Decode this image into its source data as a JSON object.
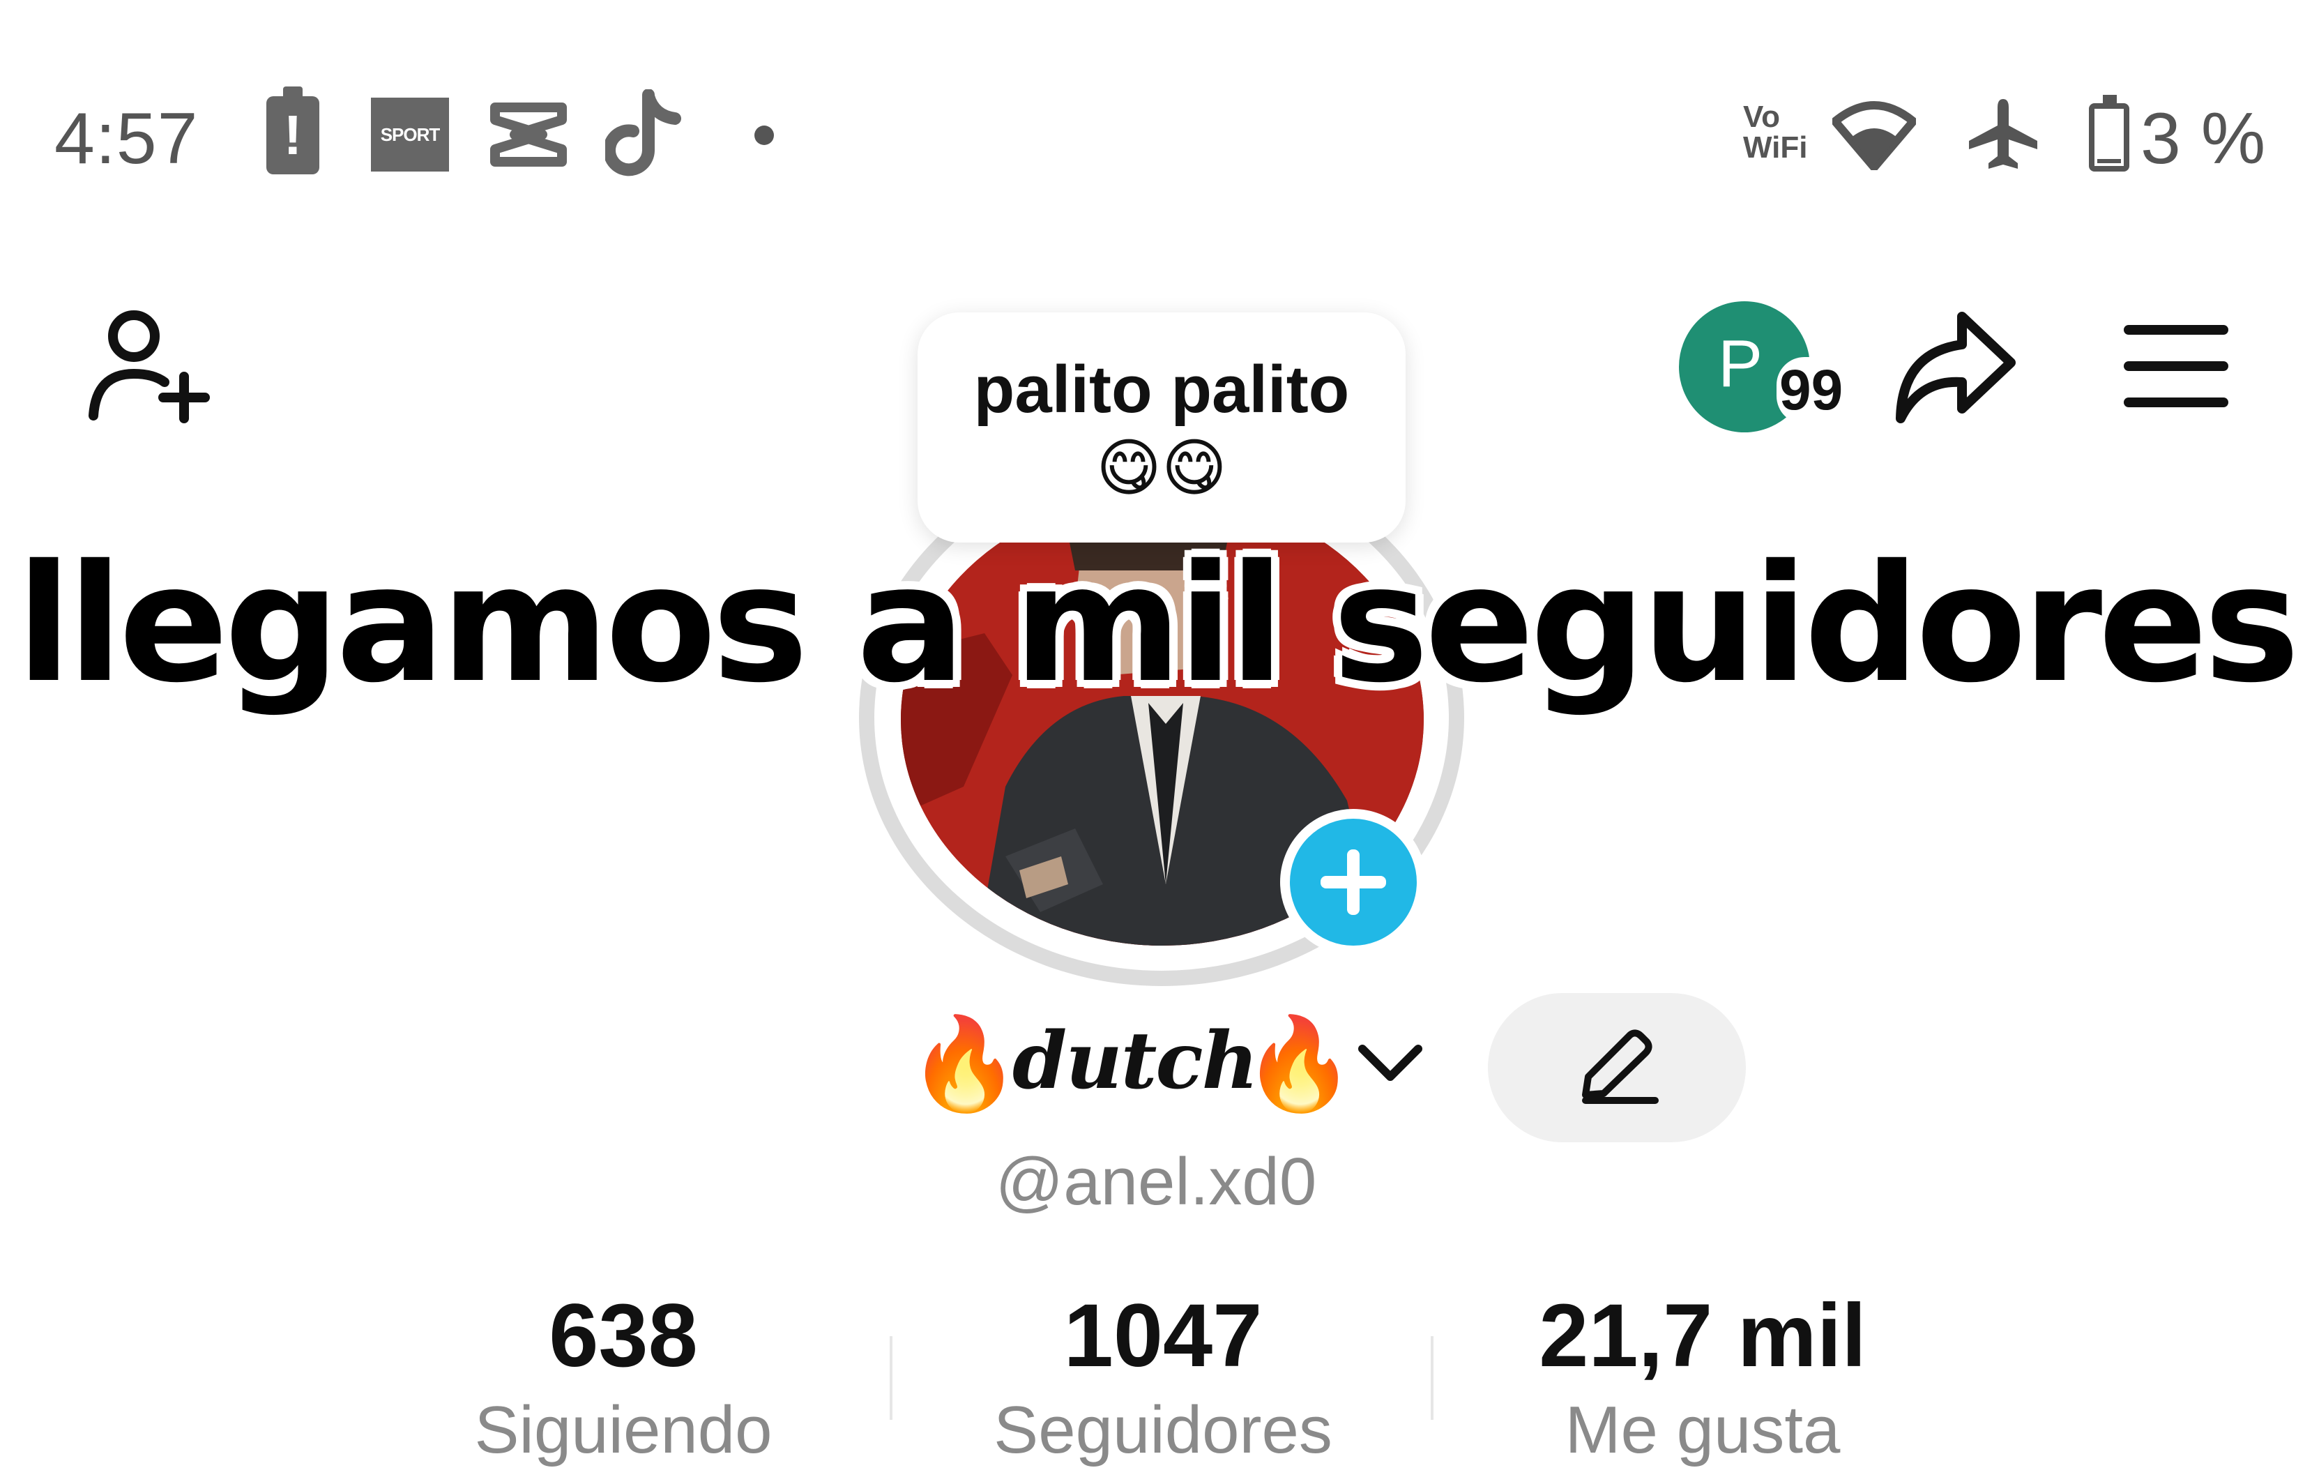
{
  "status_bar": {
    "time": "4:57",
    "battery_alert_glyph": "!",
    "sport_app_label": "SPORT",
    "vowifi_line1": "Vo",
    "vowifi_line2": "WiFi",
    "battery_percent": "3 %",
    "left_icons": [
      "battery-alert-icon",
      "sport-app-icon",
      "capcut-icon",
      "tiktok-icon",
      "notification-dot-icon"
    ],
    "right_icons": [
      "vowifi-icon",
      "wifi-icon",
      "airplane-mode-icon",
      "battery-icon"
    ]
  },
  "top_bar": {
    "icons": [
      "add-friend-icon",
      "share-icon",
      "menu-icon"
    ],
    "profile_views_badge": {
      "letter": "P",
      "count": "99",
      "color": "#1f8f73"
    }
  },
  "note": {
    "text": "palito palito",
    "emoji": "😋😋"
  },
  "overlay_caption": "llegamos a mil seguidores",
  "profile": {
    "fire_left": "🔥",
    "display_name": "dutch",
    "fire_right": "🔥",
    "handle": "@anel.xd0",
    "add_story_color": "#21b8e6"
  },
  "stats": [
    {
      "value": "638",
      "label": "Siguiendo"
    },
    {
      "value": "1047",
      "label": "Seguidores"
    },
    {
      "value": "21,7 mil",
      "label": "Me gusta"
    }
  ]
}
